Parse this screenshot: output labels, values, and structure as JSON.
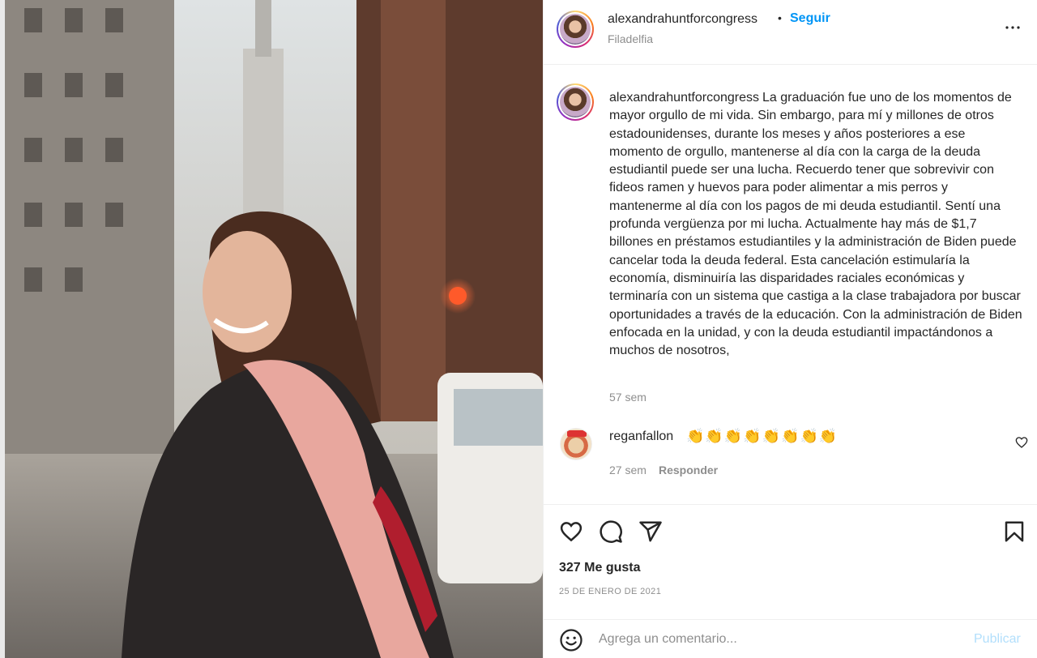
{
  "post": {
    "username": "alexandrahuntforcongress",
    "separator": "•",
    "follow_label": "Seguir",
    "location": "Filadelfia",
    "more_icon": "more-options-icon",
    "caption_text": "La graduación fue uno de los momentos de mayor orgullo de mi vida. Sin embargo, para mí y millones de otros estadounidenses, durante los meses y años posteriores a ese momento de orgullo, mantenerse al día con la carga de la deuda estudiantil puede ser una lucha. Recuerdo tener que sobrevivir con fideos ramen y huevos para poder alimentar a mis perros y mantenerme al día con los pagos de mi deuda estudiantil. Sentí una profunda vergüenza por mi lucha. Actualmente hay más de $1,7 billones en préstamos estudiantiles y la administración de Biden puede cancelar toda la deuda federal. Esta cancelación estimularía la economía, disminuiría las disparidades raciales económicas y terminaría con un sistema que castiga a la clase trabajadora por buscar oportunidades a través de la educación. Con la administración de Biden enfocada en la unidad, y con la deuda estudiantil impactándonos a muchos de nosotros,",
    "caption_time": "57 sem"
  },
  "comments": [
    {
      "username": "reganfallon",
      "text": "👏👏👏👏👏👏👏👏",
      "time": "27 sem",
      "reply_label": "Responder"
    }
  ],
  "actions": {
    "icons": [
      "heart-icon",
      "comment-icon",
      "share-icon",
      "bookmark-icon"
    ],
    "likes": "327 Me gusta",
    "date": "25 DE ENERO DE 2021"
  },
  "comment_bar": {
    "placeholder": "Agrega un comentario...",
    "publish_label": "Publicar"
  },
  "colors": {
    "link_blue": "#0095f6",
    "publish_disabled": "#b2dffc",
    "secondary_text": "#8e8e8e"
  }
}
